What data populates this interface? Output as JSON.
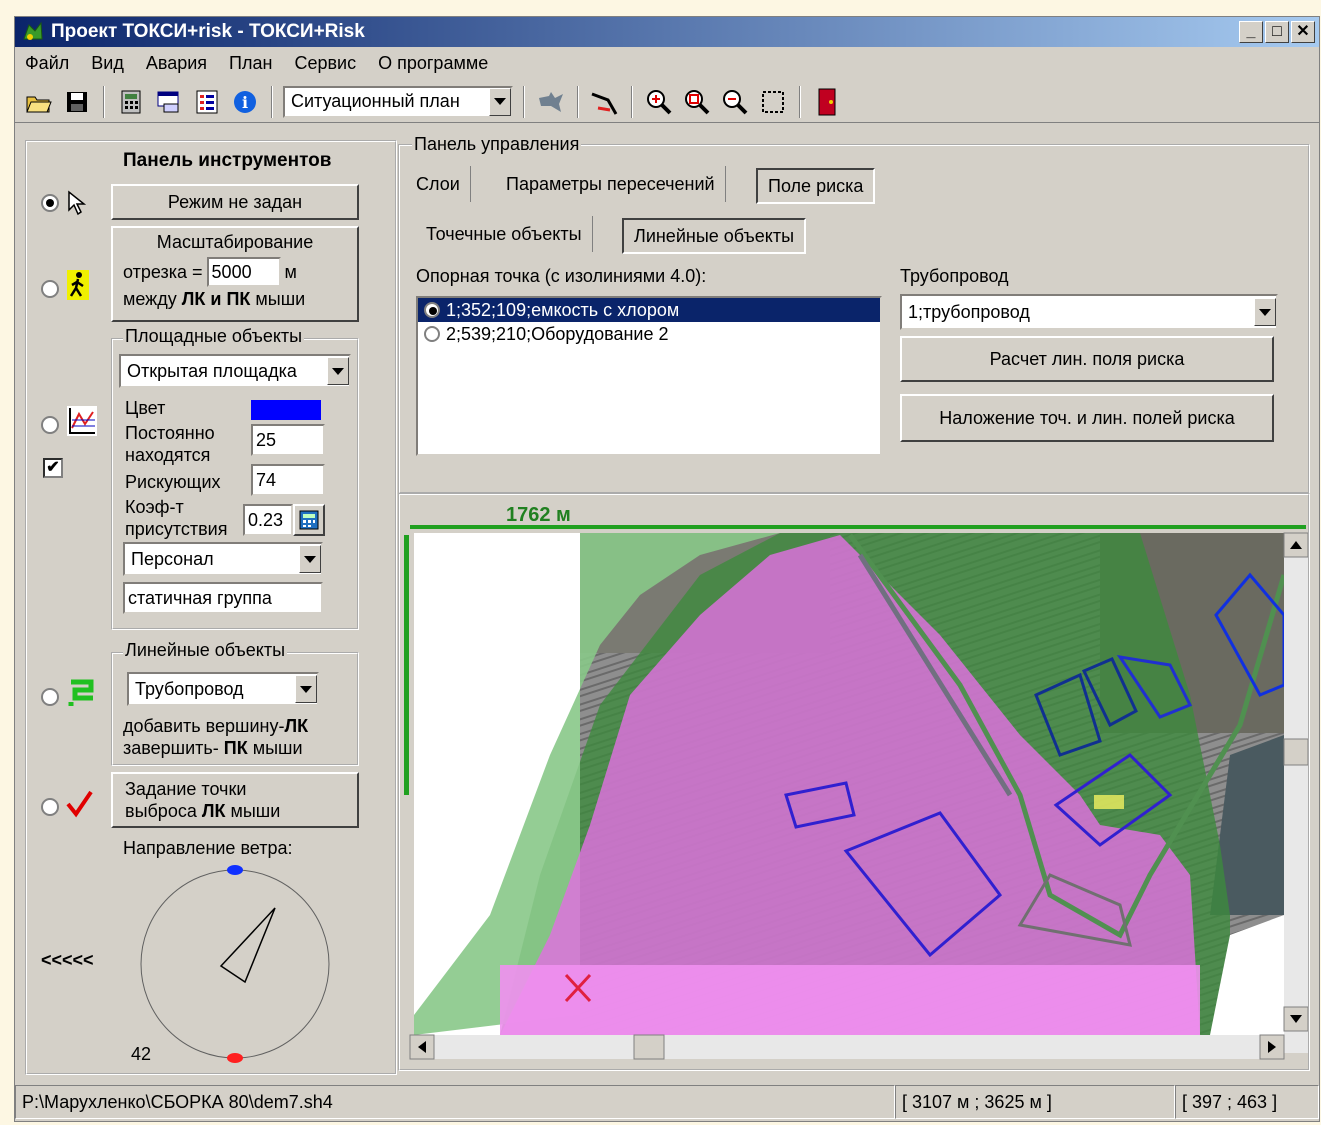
{
  "window": {
    "title": "Проект ТОКСИ+risk - ТОКСИ+Risk",
    "btn_min": "_",
    "btn_max": "□",
    "btn_close": "✕"
  },
  "menu": [
    "Файл",
    "Вид",
    "Авария",
    "План",
    "Сервис",
    "О программе"
  ],
  "toolbar": {
    "view_select": "Ситуационный план"
  },
  "tools": {
    "title": "Панель инструментов",
    "mode_button": "Режим не задан",
    "scale": {
      "title": "Масштабирование",
      "segment_label": "отрезка =",
      "segment_value": "5000",
      "unit": "м",
      "hint_prefix": "между ",
      "hint_lk": "ЛК",
      "hint_and": " и ",
      "hint_pk": "ПК",
      "hint_suffix": " мыши"
    },
    "area": {
      "legend": "Площадные объекты",
      "type": "Открытая площадка",
      "color_label": "Цвет",
      "color": "#0000ff",
      "present_label": "Постоянно находятся",
      "present_value": "25",
      "risk_label": "Рискующих",
      "risk_value": "74",
      "coef_label": "Коэф-т присутствия",
      "coef_value": "0.23",
      "personnel": "Персонал",
      "group": "статичная группа"
    },
    "linear": {
      "legend": "Линейные объекты",
      "type": "Трубопровод",
      "hint1_prefix": "добавить вершину-",
      "hint1_key": "ЛК",
      "hint2_prefix": "завершить- ",
      "hint2_key": "ПК",
      "hint2_suffix": " мыши"
    },
    "release": {
      "line1": "Задание точки",
      "line2_prefix": "выброса ",
      "line2_key": "ЛК",
      "line2_suffix": " мыши"
    },
    "wind": {
      "label": "Направление ветра:",
      "value": "42",
      "arrows": "<<<<<"
    }
  },
  "control": {
    "legend": "Панель управления",
    "tabs": [
      "Слои",
      "Параметры пересечений",
      "Поле риска"
    ],
    "subtabs": [
      "Точечные объекты",
      "Линейные объекты"
    ],
    "ref_label": "Опорная точка (с изолиниями 4.0):",
    "ref_items": [
      "1;352;109;емкость с хлором",
      "2;539;210;Оборудование 2"
    ],
    "pipe_label": "Трубопровод",
    "pipe_value": "1;трубопровод",
    "calc_button": "Расчет лин. поля риска",
    "overlay_button": "Наложение точ. и лин. полей риска"
  },
  "map": {
    "scale_label": "1762 м"
  },
  "status": {
    "path": "P:\\Марухленко\\СБОРКА 80\\dem7.sh4",
    "coords_m": "[ 3107 м ; 3625 м ]",
    "coords_px": "[ 397 ; 463 ]"
  }
}
